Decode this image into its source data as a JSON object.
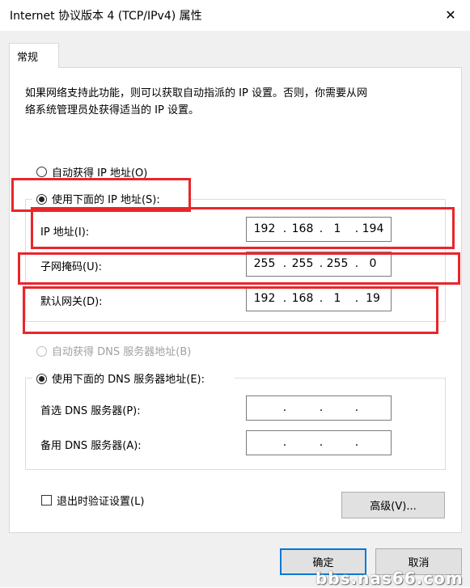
{
  "window": {
    "title": "Internet 协议版本 4 (TCP/IPv4) 属性",
    "close_glyph": "✕"
  },
  "tabs": [
    {
      "label": "常规",
      "selected": true
    }
  ],
  "description": {
    "line1": "如果网络支持此功能，则可以获取自动指派的 IP 设置。否则，你需要从网",
    "line2": "络系统管理员处获得适当的 IP 设置。"
  },
  "ip_section": {
    "auto_label": "自动获得 IP 地址(O)",
    "manual_label": "使用下面的 IP 地址(S):",
    "selected": "manual",
    "fields": [
      {
        "label": "IP 地址(I):",
        "octets": [
          "192",
          "168",
          "1",
          "194"
        ]
      },
      {
        "label": "子网掩码(U):",
        "octets": [
          "255",
          "255",
          "255",
          "0"
        ]
      },
      {
        "label": "默认网关(D):",
        "octets": [
          "192",
          "168",
          "1",
          "19"
        ]
      }
    ]
  },
  "dns_section": {
    "auto_label": "自动获得 DNS 服务器地址(B)",
    "auto_disabled": true,
    "manual_label": "使用下面的 DNS 服务器地址(E):",
    "selected": "manual",
    "fields": [
      {
        "label": "首选 DNS 服务器(P):",
        "octets": [
          "",
          "",
          "",
          ""
        ]
      },
      {
        "label": "备用 DNS 服务器(A):",
        "octets": [
          "",
          "",
          "",
          ""
        ]
      }
    ]
  },
  "validate_checkbox": {
    "label": "退出时验证设置(L)",
    "checked": false
  },
  "buttons": {
    "advanced": "高级(V)...",
    "ok": "确定",
    "cancel": "取消"
  },
  "watermark": "bbs.nas66.com",
  "colors": {
    "highlight_box": "#e8262b",
    "default_button_border": "#0078d7"
  }
}
